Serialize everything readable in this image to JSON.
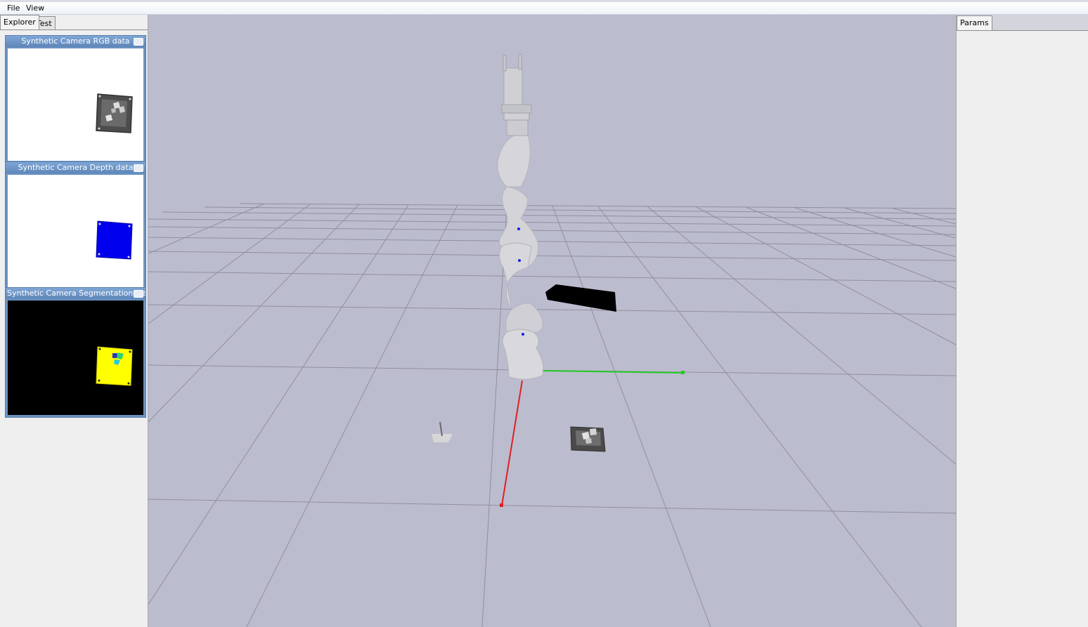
{
  "menu": {
    "file": "File",
    "view": "View"
  },
  "left_tabs": {
    "explorer": "Explorer",
    "test": "Test"
  },
  "cameras": [
    {
      "title": "Synthetic Camera RGB data"
    },
    {
      "title": "Synthetic Camera Depth data"
    },
    {
      "title": "Synthetic Camera Segmentation Mask"
    }
  ],
  "right_tabs": {
    "params": "Params"
  },
  "colors": {
    "viewport_bg": "#bcbccf",
    "axis_x": "#e02020",
    "axis_y": "#22cc22",
    "depth_blue": "#0000ee",
    "segmentation_yellow": "#ffff00",
    "grid_line": "#8f8f9c"
  }
}
